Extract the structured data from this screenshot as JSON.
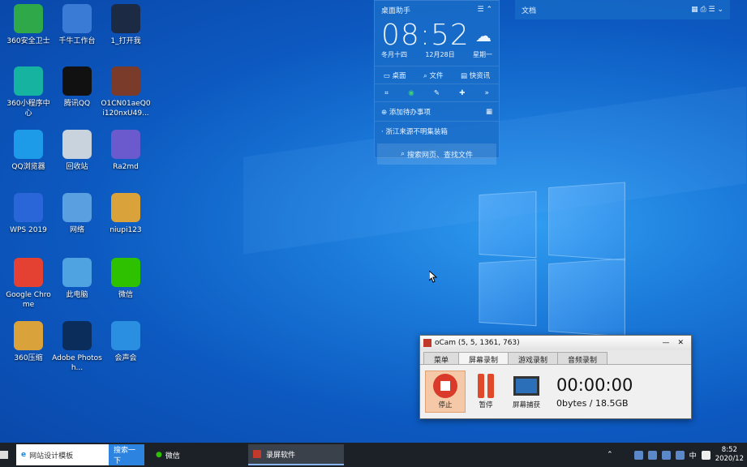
{
  "desktop_icons": [
    {
      "label": "360安全卫士",
      "icon": "360-safe-icon",
      "color": "#2fa84a"
    },
    {
      "label": "千牛工作台",
      "icon": "qianniu-icon",
      "color": "#3a7bd5"
    },
    {
      "label": "1_打开我",
      "icon": "chart-app-icon",
      "color": "#1d2a44"
    },
    {
      "label": "360小程序中心",
      "icon": "360-miniapp-icon",
      "color": "#16b3a0"
    },
    {
      "label": "腾讯QQ",
      "icon": "qq-icon",
      "color": "#111111"
    },
    {
      "label": "O1CN01aeQ0i120nxU49...",
      "icon": "photo-thumbnail-icon",
      "color": "#7a3b2a"
    },
    {
      "label": "QQ浏览器",
      "icon": "qq-browser-icon",
      "color": "#1e9be8"
    },
    {
      "label": "回收站",
      "icon": "recycle-bin-icon",
      "color": "#c8d3de"
    },
    {
      "label": "Ra2md",
      "icon": "ra2-icon",
      "color": "#6a5acd"
    },
    {
      "label": "WPS 2019",
      "icon": "wps-icon",
      "color": "#2b66d9"
    },
    {
      "label": "网络",
      "icon": "network-icon",
      "color": "#5aa0e0"
    },
    {
      "label": "niupi123",
      "icon": "archive-icon",
      "color": "#d9a23a"
    },
    {
      "label": "Google Chrome",
      "icon": "chrome-icon",
      "color": "#e44133"
    },
    {
      "label": "此电脑",
      "icon": "this-pc-icon",
      "color": "#4fa3e0"
    },
    {
      "label": "微信",
      "icon": "wechat-icon",
      "color": "#2dc100"
    },
    {
      "label": "360压缩",
      "icon": "360-zip-icon",
      "color": "#d9a23a"
    },
    {
      "label": "Adobe Photosh...",
      "icon": "photoshop-icon",
      "color": "#0b2d5b"
    },
    {
      "label": "会声会",
      "icon": "video-editor-icon",
      "color": "#2a8fe0"
    }
  ],
  "widget": {
    "title": "桌面助手",
    "hour": "08",
    "minute": "52",
    "lunar": "冬月十四",
    "date": "12月28日",
    "weekday": "星期一",
    "links": [
      "桌面",
      "文件",
      "快资讯"
    ],
    "todo": "添加待办事项",
    "news": "浙江来源不明集装箱",
    "search": "搜索网页、查找文件"
  },
  "docs": {
    "title": "文档"
  },
  "ocam": {
    "title": "oCam (5, 5, 1361, 763)",
    "tabs": [
      "菜单",
      "屏幕录制",
      "游戏录制",
      "音频录制"
    ],
    "stop": "停止",
    "pause": "暂停",
    "capture": "屏幕捕获",
    "time": "00:00:00",
    "size": "0bytes / 18.5GB"
  },
  "taskbar": {
    "search_text": "网站设计模板",
    "search_button": "搜索一下",
    "wechat": "微信",
    "recorder": "录屏软件",
    "ime": "中",
    "time": "8:52",
    "date": "2020/12"
  }
}
